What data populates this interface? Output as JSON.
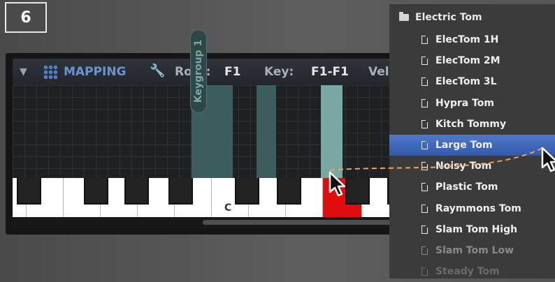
{
  "step_number": "6",
  "mapping_panel": {
    "title": "MAPPING",
    "root_label": "Root:",
    "root_value": "F1",
    "key_label": "Key:",
    "key_value": "F1-F1",
    "vel_label": "Vel:",
    "keygroup_label": "Keygroup 1",
    "keyboard_marker": "C",
    "active_key_color": "#e00d0d"
  },
  "browser": {
    "folder": "Electric Tom",
    "items": [
      {
        "label": "ElecTom 1H",
        "state": "normal"
      },
      {
        "label": "ElecTom 2M",
        "state": "normal"
      },
      {
        "label": "ElecTom 3L",
        "state": "normal"
      },
      {
        "label": "Hypra Tom",
        "state": "normal"
      },
      {
        "label": "Kitch Tommy",
        "state": "normal"
      },
      {
        "label": "Large Tom",
        "state": "selected"
      },
      {
        "label": "Noisy Tom",
        "state": "normal"
      },
      {
        "label": "Plastic Tom",
        "state": "normal"
      },
      {
        "label": "Raymmons Tom",
        "state": "normal"
      },
      {
        "label": "Slam Tom High",
        "state": "normal"
      },
      {
        "label": "Slam Tom Low",
        "state": "faded"
      },
      {
        "label": "Steady Tom",
        "state": "faint"
      }
    ],
    "selection_color": "#3f68bd"
  },
  "drag_line_color": "#f0a060"
}
